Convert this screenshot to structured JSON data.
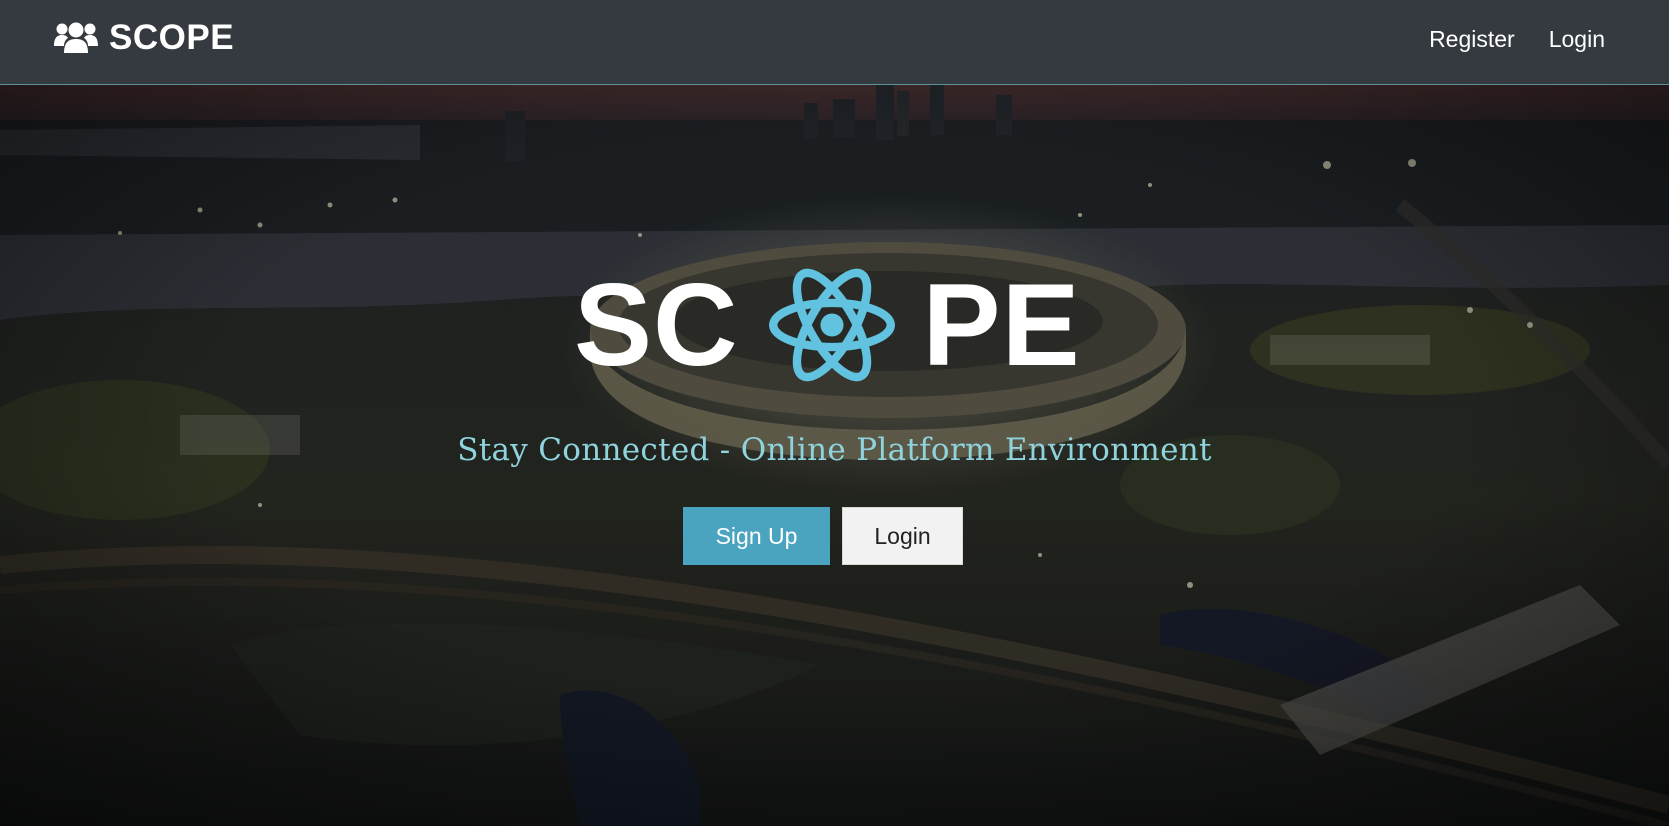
{
  "navbar": {
    "brand_icon": "users-icon",
    "brand_text": "SCOPE",
    "links": [
      {
        "label": "Register"
      },
      {
        "label": "Login"
      }
    ]
  },
  "hero": {
    "background": "city-stadium-night-photo",
    "logo": {
      "left_text": "SC",
      "icon": "react-atom-icon",
      "right_text": "PE"
    },
    "tagline": "Stay Connected - Online Platform Environment",
    "buttons": {
      "signup_label": "Sign Up",
      "login_label": "Login"
    }
  },
  "colors": {
    "navbar_bg": "#343a40",
    "accent": "#4aa3bf",
    "tagline": "#8fd3dd",
    "atom": "#61c3df"
  }
}
